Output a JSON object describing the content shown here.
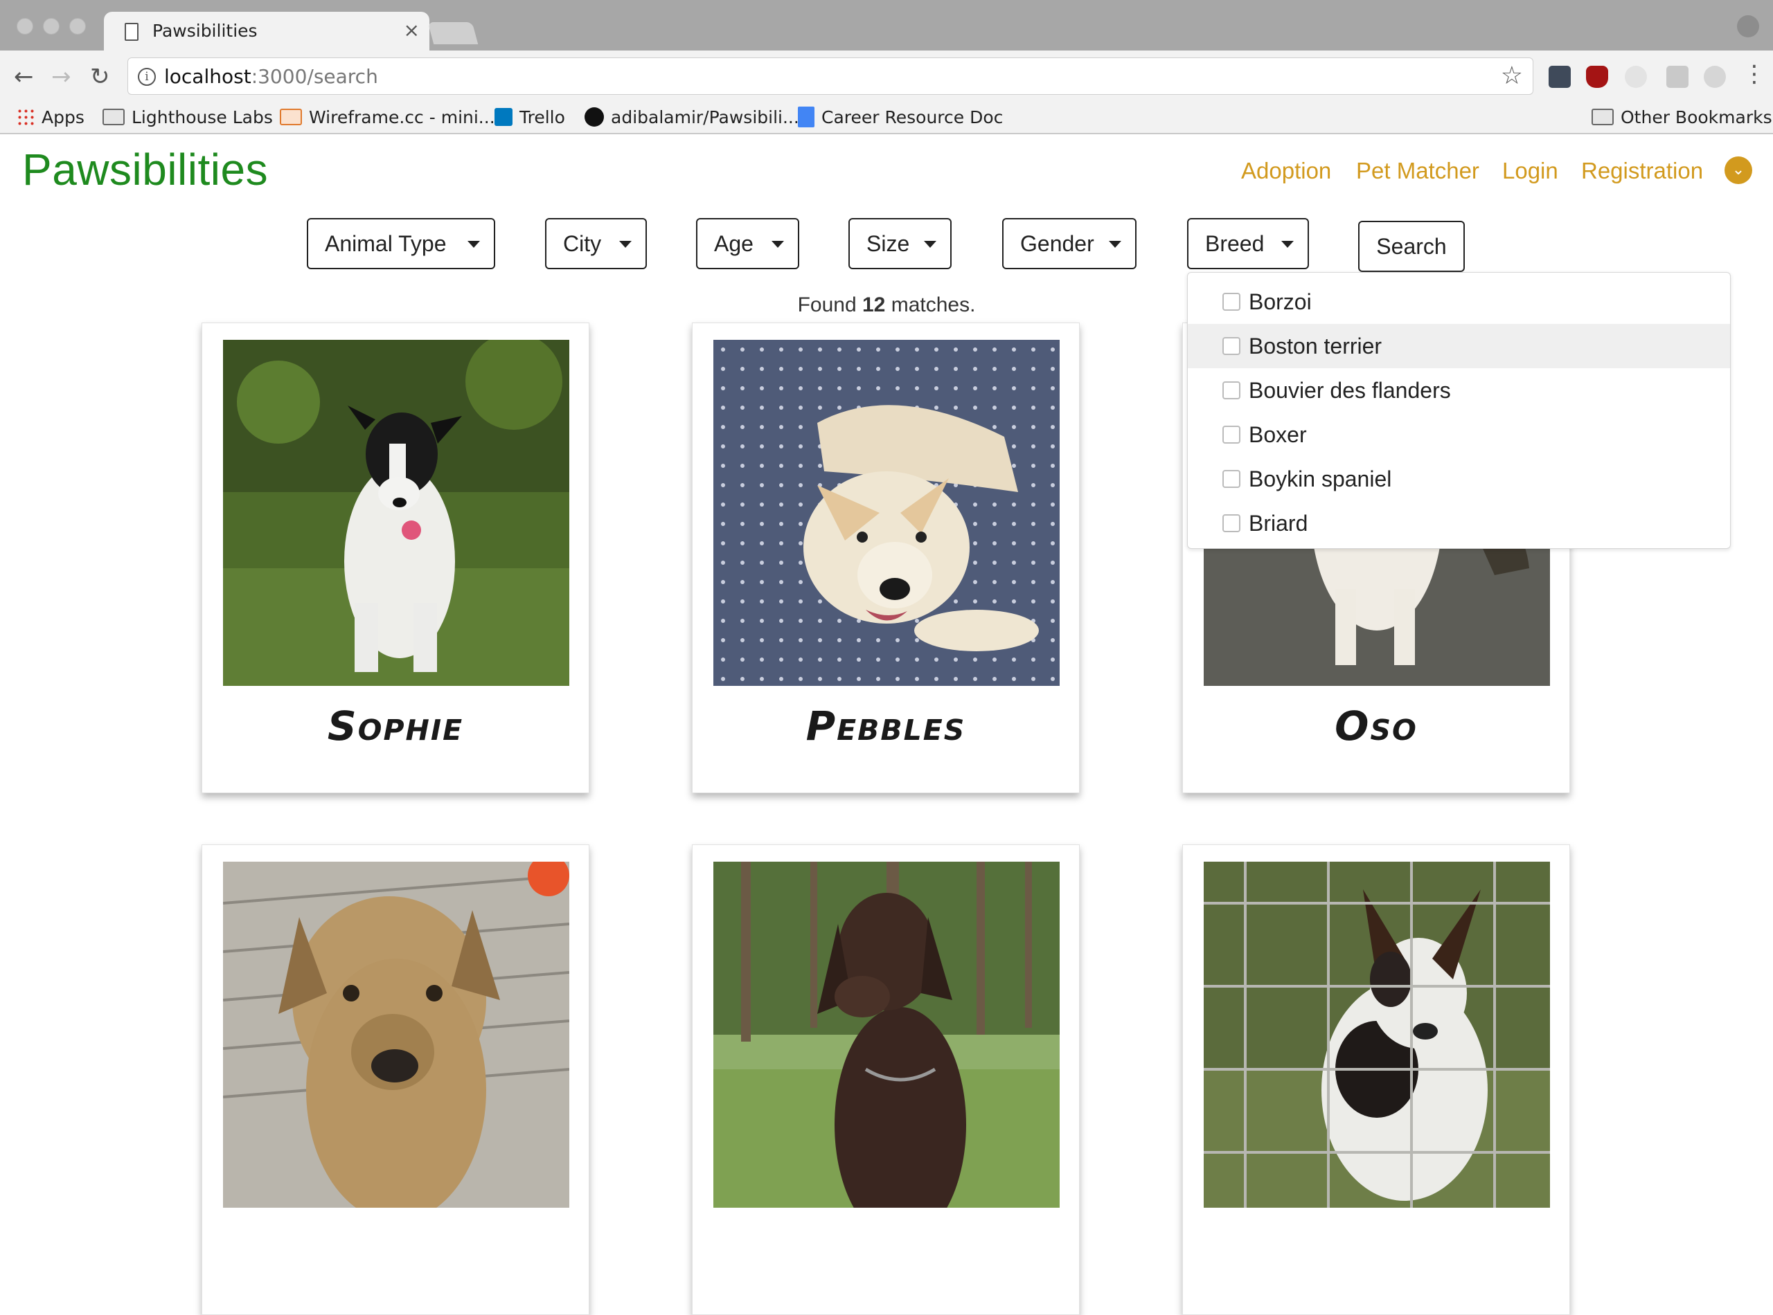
{
  "browser": {
    "tab_title": "Pawsibilities",
    "tab_close": "×",
    "url_host": "localhost",
    "url_path": ":3000/search",
    "back_glyph": "←",
    "forward_glyph": "→",
    "reload_glyph": "↻",
    "star_glyph": "☆",
    "menu_glyph": "⋮",
    "bookmarks": {
      "apps": "Apps",
      "lighthouse": "Lighthouse Labs",
      "wireframe": "Wireframe.cc - mini...",
      "trello": "Trello",
      "github": "adibalamir/Pawsibili...",
      "career": "Career Resource Doc",
      "other": "Other Bookmarks"
    }
  },
  "app": {
    "brand": "Pawsibilities",
    "brand_color": "#1e8a1e",
    "accent_color": "#d29a1e",
    "nav": {
      "adoption": "Adoption",
      "pet_matcher": "Pet Matcher",
      "login": "Login",
      "registration": "Registration"
    },
    "filters": {
      "animal_type": "Animal Type",
      "city": "City",
      "age": "Age",
      "size": "Size",
      "gender": "Gender",
      "breed": "Breed",
      "search": "Search"
    },
    "results": {
      "prefix": "Found",
      "count": "12",
      "suffix": "matches."
    },
    "breed_options": [
      "Borzoi",
      "Boston terrier",
      "Bouvier des flanders",
      "Boxer",
      "Boykin spaniel",
      "Briard"
    ],
    "breed_hovered": "Boston terrier",
    "pets": [
      {
        "name": "Sophie"
      },
      {
        "name": "Pebbles"
      },
      {
        "name": "Oso"
      },
      {
        "name": ""
      },
      {
        "name": ""
      },
      {
        "name": ""
      }
    ]
  }
}
